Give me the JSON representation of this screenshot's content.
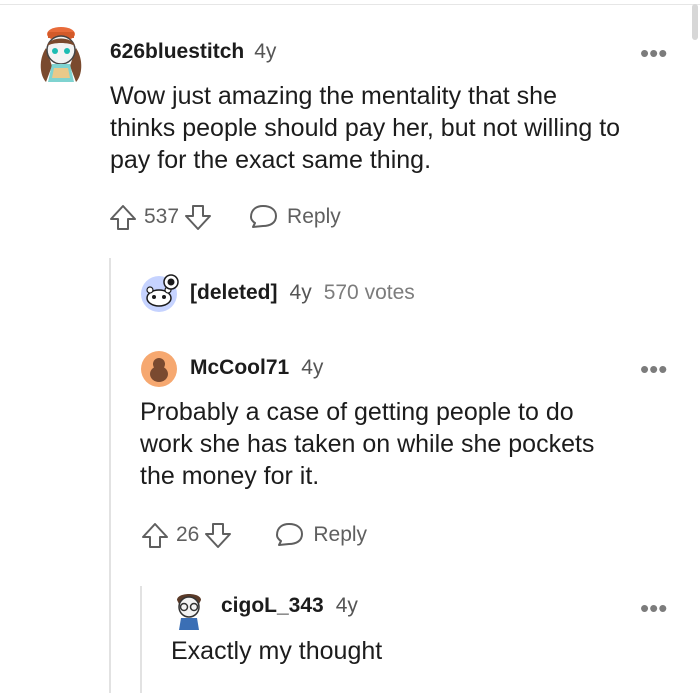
{
  "comments": [
    {
      "username": "626bluestitch",
      "age": "4y",
      "text_lines": [
        "Wow just amazing the mentality that she",
        "thinks people should pay her, but not willing to",
        "pay for the exact same thing."
      ],
      "score": "537",
      "reply_label": "Reply"
    },
    {
      "username": "[deleted]",
      "age": "4y",
      "votes": "570 votes"
    },
    {
      "username": "McCool71",
      "age": "4y",
      "text_lines": [
        "Probably a case of getting people to do",
        "work she has taken on while she pockets",
        "the money for it."
      ],
      "score": "26",
      "reply_label": "Reply"
    },
    {
      "username": "cigoL_343",
      "age": "4y",
      "text_lines": [
        "Exactly my thought"
      ]
    }
  ],
  "more_label": "•••",
  "colors": {
    "accent": "#ff4500",
    "icon_gray": "#5f5f5f",
    "deleted_avatar": "#c6d3ff",
    "mccool_avatar": "#f6a870"
  }
}
